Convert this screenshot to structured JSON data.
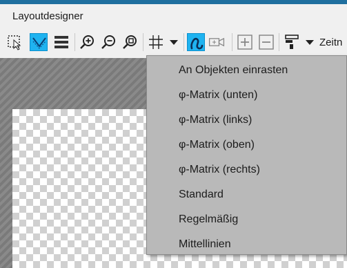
{
  "window": {
    "title": "Layoutdesigner"
  },
  "toolbar": {
    "buttons": [
      {
        "name": "select-tool",
        "icon": "selection-box-icon",
        "active": false
      },
      {
        "name": "snap-tool",
        "icon": "snap-lines-icon",
        "active": true
      },
      {
        "name": "align-tool",
        "icon": "stacked-lines-icon",
        "active": false
      },
      {
        "name": "zoom-in",
        "icon": "zoom-in-icon",
        "active": false
      },
      {
        "name": "zoom-out",
        "icon": "zoom-out-icon",
        "active": false
      },
      {
        "name": "zoom-fit",
        "icon": "zoom-fit-icon",
        "active": false
      },
      {
        "name": "grid",
        "icon": "grid-icon",
        "active": false
      },
      {
        "name": "path",
        "icon": "curve-path-icon",
        "active": true
      },
      {
        "name": "camera",
        "icon": "camera-icon",
        "active": false
      },
      {
        "name": "add",
        "icon": "plus-icon",
        "active": false
      },
      {
        "name": "remove",
        "icon": "minus-icon",
        "active": false
      },
      {
        "name": "layout",
        "icon": "layout-icon",
        "active": false
      }
    ],
    "overflow_label": "Zeitn",
    "active_color": "#1fb3f0"
  },
  "grid_menu": {
    "items": [
      "An Objekten einrasten",
      "φ-Matrix (unten)",
      "φ-Matrix (links)",
      "φ-Matrix (oben)",
      "φ-Matrix (rechts)",
      "Standard",
      "Regelmäßig",
      "Mittellinien"
    ]
  }
}
